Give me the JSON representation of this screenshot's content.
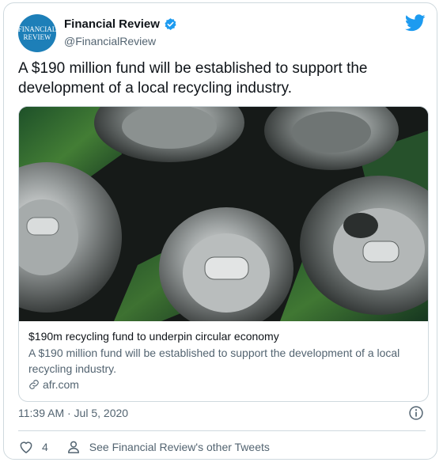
{
  "author": {
    "avatar_line1": "FINANCIAL",
    "avatar_line2": "REVIEW",
    "display_name": "Financial Review",
    "handle": "@FinancialReview",
    "verified_icon": "verified-badge-icon",
    "avatar_color": "#1d7fb8"
  },
  "brand": {
    "logo_icon": "twitter-bird-icon",
    "color": "#1d9bf0"
  },
  "tweet": {
    "text": "A $190 million fund will be established to support the development of a local recycling industry.",
    "timestamp": "11:39 AM · Jul 5, 2020"
  },
  "link_card": {
    "image_icon": "crushed-aluminium-cans-photo",
    "title": "$190m recycling fund to underpin circular economy",
    "description": "A $190 million fund will be established to support the development of a local recycling industry.",
    "domain": "afr.com"
  },
  "footer": {
    "like_count": "4",
    "see_other": "See Financial Review's other Tweets"
  },
  "colors": {
    "text": "#0f1419",
    "secondary": "#536471",
    "border": "#cfd9de"
  }
}
